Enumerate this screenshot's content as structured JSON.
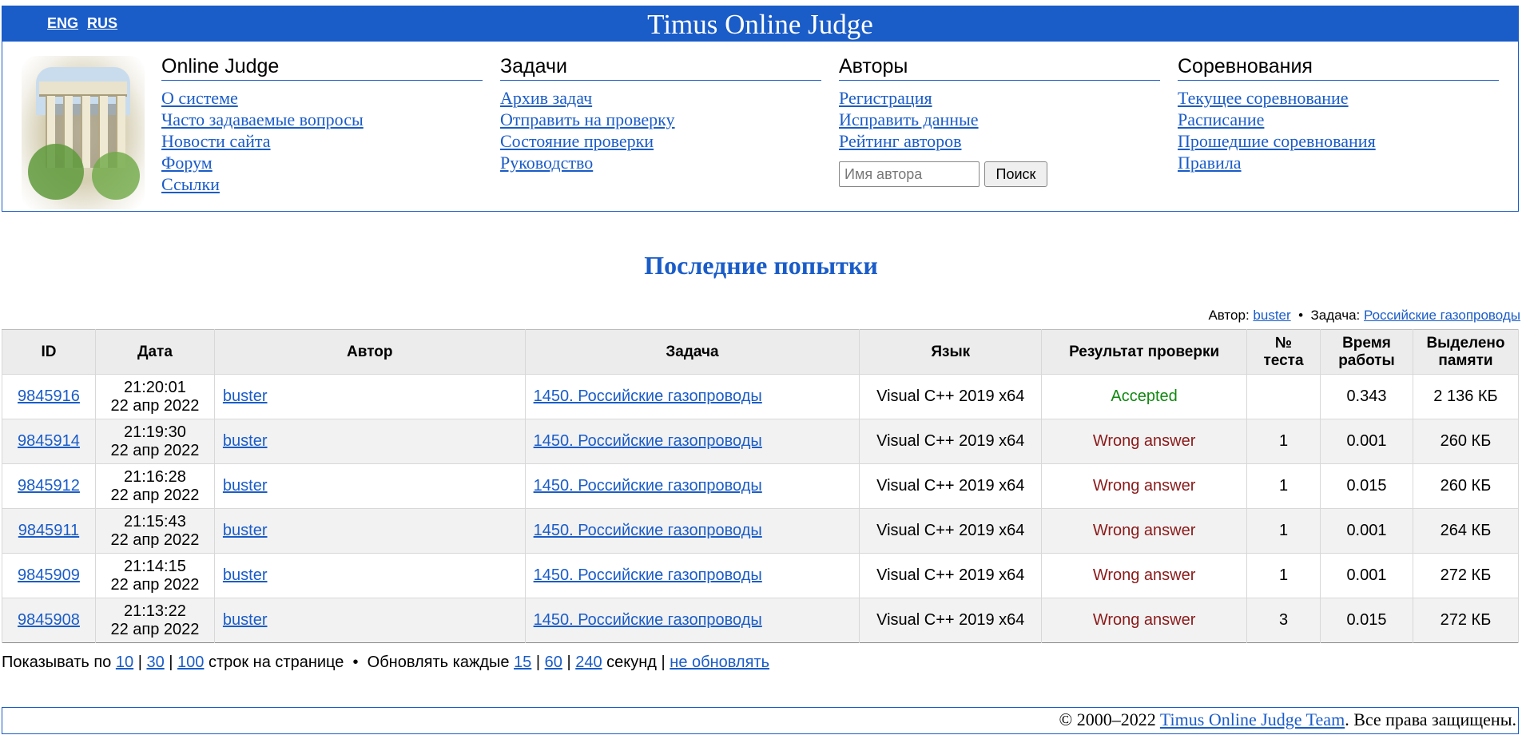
{
  "header": {
    "lang_eng": "ENG",
    "lang_rus": "RUS",
    "site_title": "Timus Online Judge",
    "columns": [
      {
        "title": "Online Judge",
        "links": [
          "О системе",
          "Часто задаваемые вопросы",
          "Новости сайта",
          "Форум",
          "Ссылки"
        ]
      },
      {
        "title": "Задачи",
        "links": [
          "Архив задач",
          "Отправить на проверку",
          "Состояние проверки",
          "Руководство"
        ]
      },
      {
        "title": "Авторы",
        "links": [
          "Регистрация",
          "Исправить данные",
          "Рейтинг авторов"
        ],
        "search_placeholder": "Имя автора",
        "search_button": "Поиск"
      },
      {
        "title": "Соревнования",
        "links": [
          "Текущее соревнование",
          "Расписание",
          "Прошедшие соревнования",
          "Правила"
        ]
      }
    ]
  },
  "main": {
    "title": "Последние попытки",
    "filter": {
      "author_label": "Автор:",
      "author": "buster",
      "separator": "•",
      "problem_label": "Задача:",
      "problem": "Российские газопроводы"
    },
    "table": {
      "headers": {
        "id": "ID",
        "date": "Дата",
        "author": "Автор",
        "problem": "Задача",
        "language": "Язык",
        "verdict": "Результат проверки",
        "test_line1": "№",
        "test_line2": "теста",
        "time_line1": "Время",
        "time_line2": "работы",
        "memory_line1": "Выделено",
        "memory_line2": "памяти"
      },
      "rows": [
        {
          "id": "9845916",
          "time": "21:20:01",
          "date": "22 апр 2022",
          "author": "buster",
          "problem": "1450. Российские газопроводы",
          "language": "Visual C++ 2019 x64",
          "verdict": "Accepted",
          "test": "",
          "runtime": "0.343",
          "memory": "2 136 КБ"
        },
        {
          "id": "9845914",
          "time": "21:19:30",
          "date": "22 апр 2022",
          "author": "buster",
          "problem": "1450. Российские газопроводы",
          "language": "Visual C++ 2019 x64",
          "verdict": "Wrong answer",
          "test": "1",
          "runtime": "0.001",
          "memory": "260 КБ"
        },
        {
          "id": "9845912",
          "time": "21:16:28",
          "date": "22 апр 2022",
          "author": "buster",
          "problem": "1450. Российские газопроводы",
          "language": "Visual C++ 2019 x64",
          "verdict": "Wrong answer",
          "test": "1",
          "runtime": "0.015",
          "memory": "260 КБ"
        },
        {
          "id": "9845911",
          "time": "21:15:43",
          "date": "22 апр 2022",
          "author": "buster",
          "problem": "1450. Российские газопроводы",
          "language": "Visual C++ 2019 x64",
          "verdict": "Wrong answer",
          "test": "1",
          "runtime": "0.001",
          "memory": "264 КБ"
        },
        {
          "id": "9845909",
          "time": "21:14:15",
          "date": "22 апр 2022",
          "author": "buster",
          "problem": "1450. Российские газопроводы",
          "language": "Visual C++ 2019 x64",
          "verdict": "Wrong answer",
          "test": "1",
          "runtime": "0.001",
          "memory": "272 КБ"
        },
        {
          "id": "9845908",
          "time": "21:13:22",
          "date": "22 апр 2022",
          "author": "buster",
          "problem": "1450. Российские газопроводы",
          "language": "Visual C++ 2019 x64",
          "verdict": "Wrong answer",
          "test": "3",
          "runtime": "0.015",
          "memory": "272 КБ"
        }
      ]
    },
    "pager": {
      "show_prefix": "Показывать по",
      "page_sizes": [
        "10",
        "30",
        "100"
      ],
      "show_suffix": "строк на странице",
      "bullet": "•",
      "refresh_prefix": "Обновлять каждые",
      "refresh_intervals": [
        "15",
        "60",
        "240"
      ],
      "refresh_suffix": "секунд",
      "no_refresh": "не обновлять",
      "pipe": "|"
    }
  },
  "footer": {
    "copyright": "© 2000–2022",
    "team_link": "Timus Online Judge Team",
    "rights": ". Все права защищены."
  },
  "colors": {
    "brand_blue": "#1a5cc8",
    "accepted": "#118811",
    "wrong_answer": "#8b1a1a"
  },
  "icons": {
    "logo": "university-building-logo"
  }
}
